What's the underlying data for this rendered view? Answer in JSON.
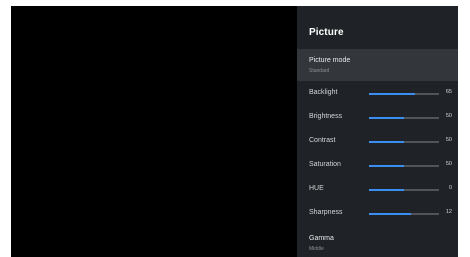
{
  "panel": {
    "title": "Picture",
    "picture_mode": {
      "label": "Picture mode",
      "value": "Standard"
    },
    "sliders": [
      {
        "label": "Backlight",
        "value": "65",
        "level": 0.65
      },
      {
        "label": "Brightness",
        "value": "50",
        "level": 0.5
      },
      {
        "label": "Contrast",
        "value": "50",
        "level": 0.5
      },
      {
        "label": "Saturation",
        "value": "50",
        "level": 0.5
      },
      {
        "label": "HUE",
        "value": "0",
        "level": 0.5
      },
      {
        "label": "Sharpness",
        "value": "12",
        "level": 0.6
      }
    ],
    "gamma": {
      "label": "Gamma",
      "value": "Middle"
    }
  },
  "colors": {
    "accent": "#3b8ef0",
    "panel_bg": "#1f2226",
    "highlight_bg": "#33373c"
  }
}
